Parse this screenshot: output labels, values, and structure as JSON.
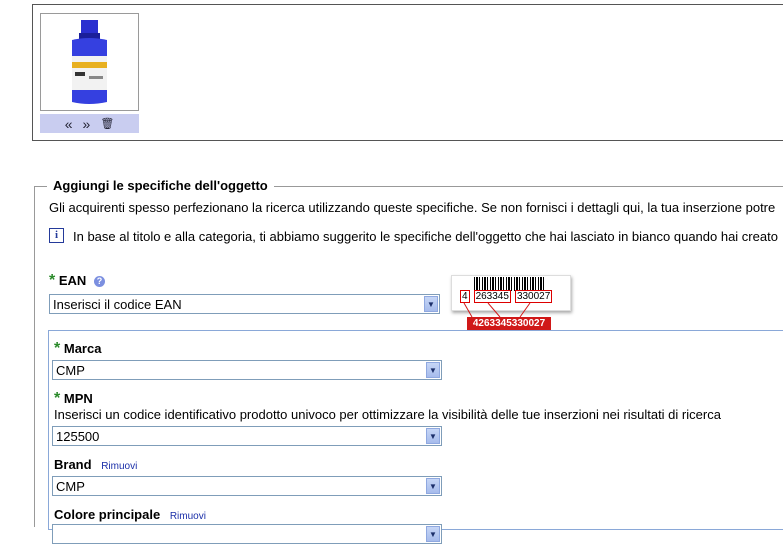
{
  "photo": {
    "thumb_alt": "CMP ink bottle",
    "controls": {
      "prev": "«",
      "next": "»",
      "delete": "🗑"
    }
  },
  "specifics": {
    "legend": "Aggiungi le specifiche dell'oggetto",
    "intro": "Gli acquirenti spesso perfezionano la ricerca utilizzando queste specifiche. Se non fornisci i dettagli qui, la tua inserzione potre",
    "info_text": "In base al titolo e alla categoria, ti abbiamo suggerito le specifiche dell'oggetto che hai lasciato in bianco quando hai creato",
    "info_icon": "i",
    "required_mark": "*",
    "ean": {
      "label": "EAN",
      "help": "?",
      "value": "Inserisci il codice EAN",
      "barcode_digits": [
        "4",
        "263345",
        "330027"
      ],
      "barcode_full": "4263345330027"
    },
    "marca": {
      "label": "Marca",
      "value": "CMP"
    },
    "mpn": {
      "label": "MPN",
      "hint": "Inserisci un codice identificativo prodotto univoco per ottimizzare la visibilità delle tue inserzioni nei risultati di ricerca",
      "value": "125500"
    },
    "brand": {
      "label": "Brand",
      "remove": "Rimuovi",
      "value": "CMP"
    },
    "colore": {
      "label": "Colore principale",
      "remove": "Rimuovi"
    }
  },
  "colors": {
    "required": "#2a8a2a",
    "link": "#1a2ea8",
    "barcode_red": "#d01818"
  }
}
